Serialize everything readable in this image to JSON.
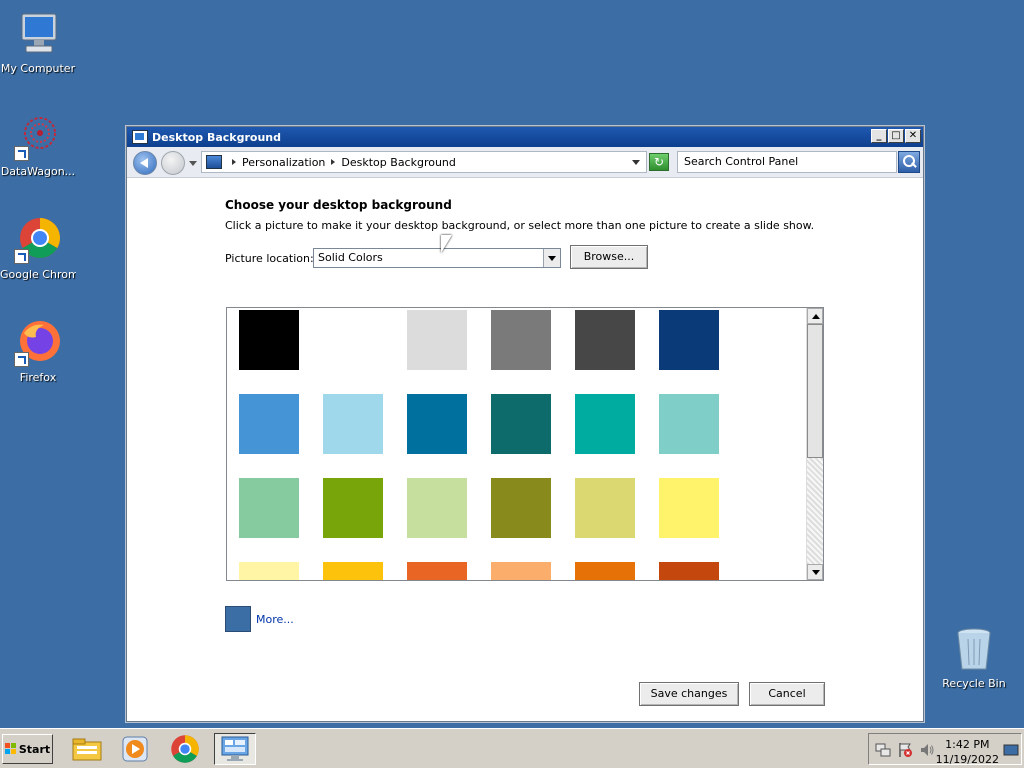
{
  "desktop": {
    "icons": [
      {
        "label": "My Computer",
        "icon": "computer-icon"
      },
      {
        "label": "DataWagon...",
        "icon": "datawagon-icon"
      },
      {
        "label": "Google Chrome",
        "icon": "chrome-icon"
      },
      {
        "label": "Firefox",
        "icon": "firefox-icon"
      },
      {
        "label": "Recycle Bin",
        "icon": "recycle-bin-icon"
      }
    ]
  },
  "window": {
    "title": "Desktop Background",
    "title_buttons": {
      "minimize": "_",
      "maximize": "□",
      "close": "✕"
    },
    "breadcrumb": [
      "Personalization",
      "Desktop Background"
    ],
    "search_placeholder": "Search Control Panel",
    "heading": "Choose your desktop background",
    "description": "Click a picture to make it your desktop background, or select more than one picture to create a slide show.",
    "picture_location_label": "Picture location:",
    "picture_location_value": "Solid Colors",
    "browse_label": "Browse...",
    "more_label": "More...",
    "more_color": "#3a6ea5",
    "save_label": "Save changes",
    "cancel_label": "Cancel"
  },
  "swatches": [
    [
      "#000000",
      "#ffffff",
      "#dcdcdc",
      "#7a7a7a",
      "#474747",
      "#0b3a78"
    ],
    [
      "#4494d6",
      "#9ed8ea",
      "#00719f",
      "#0d6b6c",
      "#00aba0",
      "#7fcec8"
    ],
    [
      "#86cba0",
      "#78a60a",
      "#c6df9f",
      "#888a1b",
      "#dbd872",
      "#fef36a"
    ],
    [
      "#fff5a5",
      "#fdc20b",
      "#e86524",
      "#fbae6b",
      "#e67106",
      "#c4470d"
    ]
  ],
  "taskbar": {
    "start_label": "Start",
    "apps": [
      "file-explorer-icon",
      "media-player-icon",
      "chrome-icon",
      "control-panel-icon"
    ],
    "clock_time": "1:42 PM",
    "clock_date": "11/19/2022"
  }
}
